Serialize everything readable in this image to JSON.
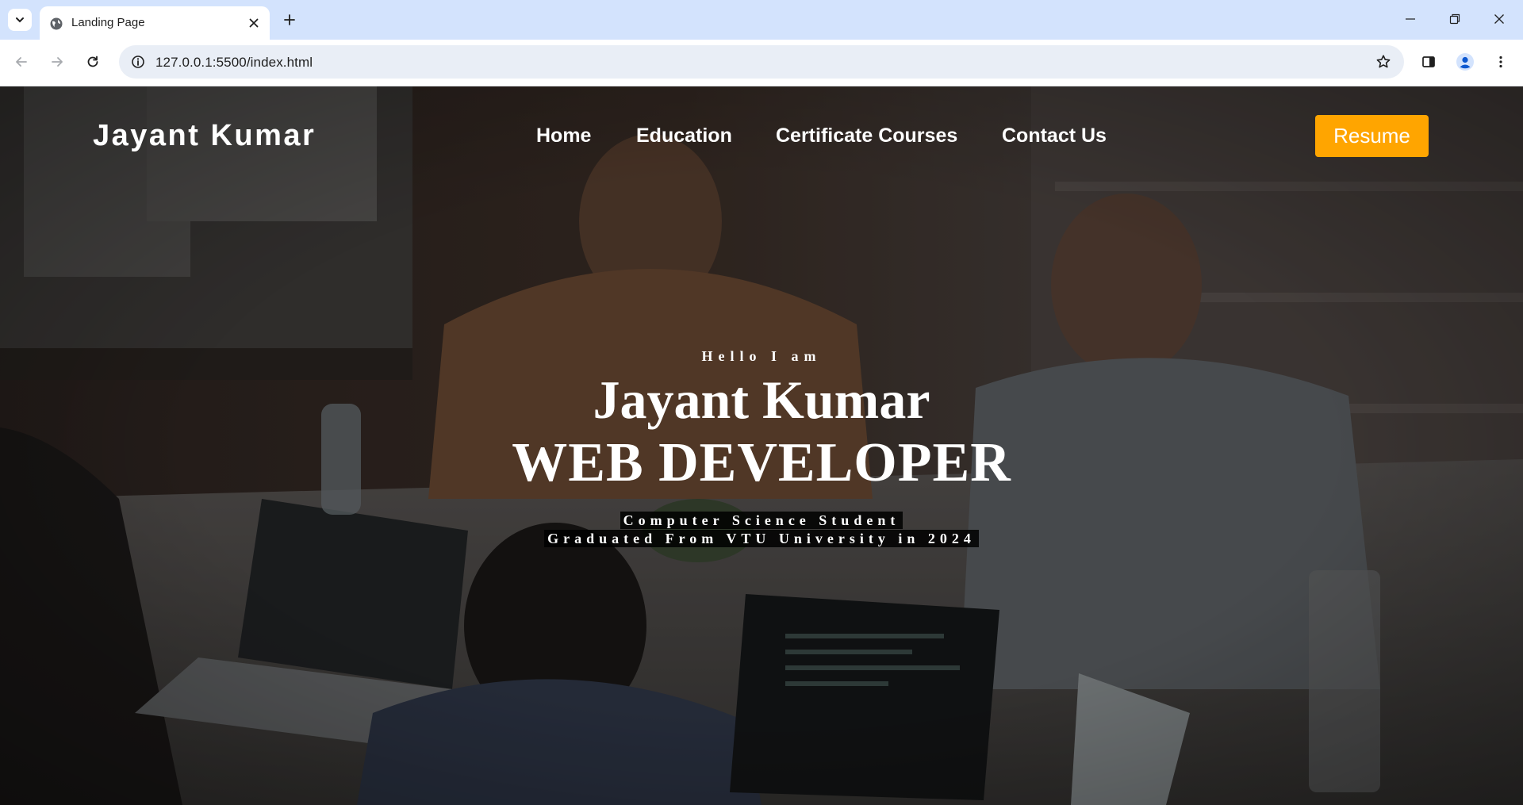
{
  "browser": {
    "tab": {
      "title": "Landing Page",
      "favicon": "globe-icon"
    },
    "address_bar": {
      "url": "127.0.0.1:5500/index.html"
    },
    "icons": {
      "tab_search": "chevron-down-icon",
      "new_tab": "plus-icon",
      "back": "arrow-left-icon",
      "forward": "arrow-right-icon",
      "reload": "reload-icon",
      "site_info": "info-icon",
      "bookmark": "star-icon",
      "side_panel": "side-panel-icon",
      "profile": "profile-icon",
      "menu": "kebab-menu-icon",
      "minimize": "minimize-icon",
      "restore": "restore-icon",
      "close": "close-icon"
    }
  },
  "page": {
    "brand": "Jayant Kumar",
    "nav": [
      {
        "label": "Home"
      },
      {
        "label": "Education"
      },
      {
        "label": "Certificate Courses"
      },
      {
        "label": "Contact Us"
      }
    ],
    "resume_button": "Resume",
    "hero": {
      "greeting": "Hello I am",
      "name": "Jayant Kumar",
      "role": "WEB DEVELOPER",
      "subtitle_1": "Computer Science Student",
      "subtitle_2": "Graduated From VTU University in 2024"
    },
    "colors": {
      "accent": "#ffa500",
      "tabstrip": "#d3e3fd",
      "omnibox": "#e9eef6",
      "overlay": "#2a2522"
    }
  }
}
